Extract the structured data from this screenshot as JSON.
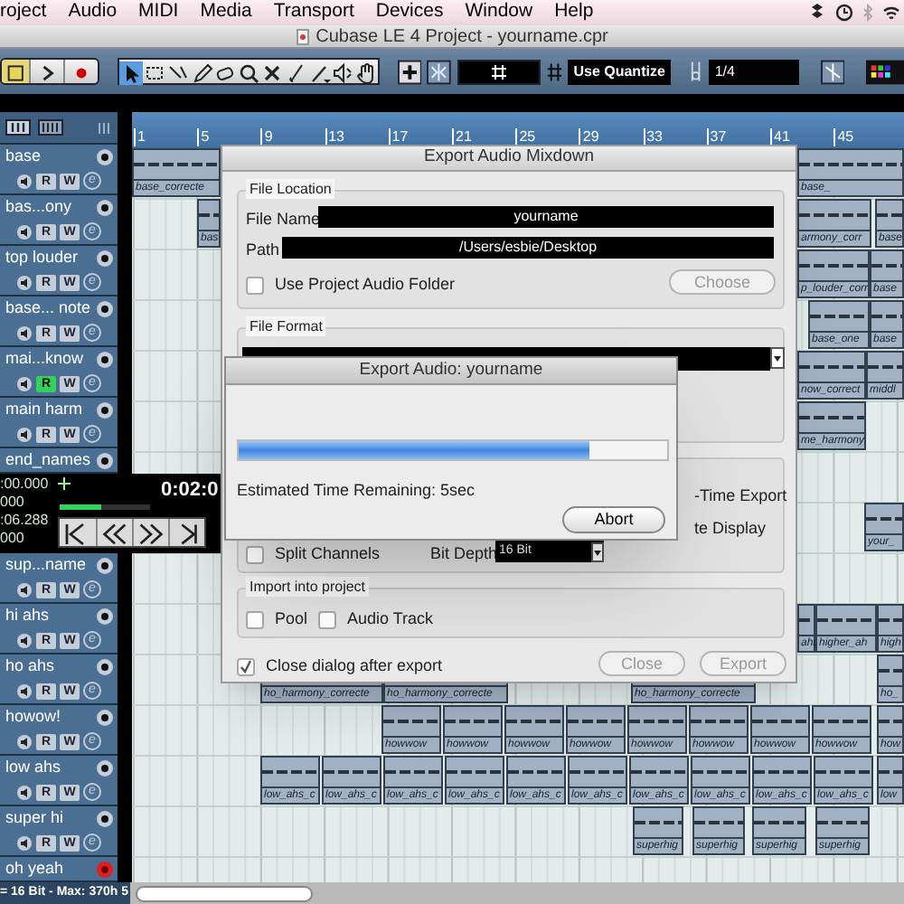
{
  "menu_bar": {
    "items": [
      "roject",
      "Audio",
      "MIDI",
      "Media",
      "Transport",
      "Devices",
      "Window",
      "Help"
    ]
  },
  "window": {
    "title": "Cubase LE 4 Project - yourname.cpr"
  },
  "toolbar": {
    "tools": [
      {
        "selected": true
      },
      {
        "selected": false
      },
      {
        "selected": false
      },
      {
        "selected": false
      },
      {
        "selected": false
      },
      {
        "selected": false
      },
      {
        "selected": false
      },
      {
        "selected": false
      },
      {
        "selected": false
      },
      {
        "selected": false
      },
      {
        "selected": false
      }
    ],
    "quantize": "Use Quantize",
    "quantize_value": "1/4"
  },
  "track_list": {
    "upper": [
      {
        "name": "base",
        "read": false,
        "record": false,
        "buttons": [
          "R",
          "W",
          "e"
        ]
      },
      {
        "name": "bas...ony",
        "read": false,
        "record": false,
        "buttons": [
          "R",
          "W",
          "e"
        ]
      },
      {
        "name": "top louder",
        "read": false,
        "record": false,
        "buttons": [
          "R",
          "W",
          "e"
        ]
      },
      {
        "name": "base... note",
        "read": false,
        "record": false,
        "buttons": [
          "R",
          "W",
          "e"
        ]
      },
      {
        "name": "mai...know",
        "read": true,
        "record": false,
        "buttons": [
          "R",
          "W",
          "e"
        ]
      },
      {
        "name": "main harm",
        "read": false,
        "record": false,
        "buttons": [
          "R",
          "W",
          "e"
        ]
      },
      {
        "name": "end_names",
        "record": false
      }
    ],
    "lower": [
      {
        "name": "sup...name",
        "read": false,
        "record": false,
        "buttons": [
          "R",
          "W",
          "e"
        ]
      },
      {
        "name": "hi ahs",
        "read": false,
        "record": false,
        "buttons": [
          "R",
          "W",
          "e"
        ]
      },
      {
        "name": "ho ahs",
        "read": false,
        "record": false,
        "buttons": [
          "R",
          "W",
          "e"
        ]
      },
      {
        "name": "howow!",
        "read": false,
        "record": false,
        "buttons": [
          "R",
          "W",
          "e"
        ]
      },
      {
        "name": "low ahs",
        "read": false,
        "record": false,
        "buttons": [
          "R",
          "W",
          "e"
        ]
      },
      {
        "name": "super hi",
        "read": false,
        "record": false,
        "buttons": [
          "R",
          "W",
          "e"
        ]
      },
      {
        "name": "oh yeah",
        "record": true
      }
    ]
  },
  "transport": {
    "time_1": ":00.000",
    "time_2": "000",
    "main_time": "0:02:0",
    "time_3": ":06.288",
    "time_4": "000",
    "level": 0.45
  },
  "ruler": [
    "1",
    "5",
    "9",
    "13",
    "17",
    "21",
    "25",
    "29",
    "33",
    "37",
    "41",
    "45"
  ],
  "clips": [
    {
      "label": "base_correcte"
    },
    {
      "label": "base_"
    },
    {
      "label": "bas"
    },
    {
      "label": "armony_corr"
    },
    {
      "label": "base"
    },
    {
      "label": "p_louder_corr"
    },
    {
      "label": "base"
    },
    {
      "label": "base_one"
    },
    {
      "label": "base"
    },
    {
      "label": "now_correct"
    },
    {
      "label": "middl"
    },
    {
      "label": "me_harmony"
    },
    {
      "label": "your_"
    },
    {
      "label": "ahs"
    },
    {
      "label": "higher_ah"
    },
    {
      "label": "high"
    },
    {
      "label": "ho_harmony_correcte"
    },
    {
      "label": "ho_harmony_correcte"
    },
    {
      "label": "ho_harmony_correcte"
    },
    {
      "label": "ho_"
    },
    {
      "label": "howwow"
    },
    {
      "label": "howwow"
    },
    {
      "label": "howwow"
    },
    {
      "label": "howwow"
    },
    {
      "label": "howwow"
    },
    {
      "label": "howwow"
    },
    {
      "label": "howwow"
    },
    {
      "label": "howwow"
    },
    {
      "label": "how"
    },
    {
      "label": "low_ahs_c"
    },
    {
      "label": "low_ahs_c"
    },
    {
      "label": "low_ahs_c"
    },
    {
      "label": "low_ahs_c"
    },
    {
      "label": "low_ahs_c"
    },
    {
      "label": "low_ahs_c"
    },
    {
      "label": "low_ahs_c"
    },
    {
      "label": "low_ahs_c"
    },
    {
      "label": "low_ahs_c"
    },
    {
      "label": "low_ahs_c"
    },
    {
      "label": "low"
    },
    {
      "label": "superhig"
    },
    {
      "label": "superhig"
    },
    {
      "label": "superhig"
    },
    {
      "label": "superhig"
    }
  ],
  "mixdown_dialog": {
    "title": "Export Audio Mixdown",
    "file_location": {
      "title": "File Location",
      "file_name_label": "File Name",
      "file_name": "yourname",
      "path_label": "Path",
      "path": "/Users/esbie/Desktop",
      "use_project_folder": {
        "label": "Use Project Audio Folder",
        "checked": false
      },
      "choose_button": "Choose"
    },
    "file_format": {
      "title": "File Format"
    },
    "options": {
      "realtime_label": "-Time Export",
      "display_label": "te Display",
      "split_channels": {
        "label": "Split Channels",
        "checked": false
      },
      "bit_depth_label": "Bit Depth",
      "bit_depth": "16 Bit"
    },
    "import": {
      "title": "Import into project",
      "pool": {
        "label": "Pool",
        "checked": false
      },
      "audio_track": {
        "label": "Audio Track",
        "checked": false
      }
    },
    "close_after": {
      "label": "Close dialog after export",
      "checked": true
    },
    "buttons": [
      "Close",
      "Export"
    ]
  },
  "progress_dialog": {
    "title": "Export Audio: yourname",
    "level": 0.82,
    "remaining": "Estimated Time Remaining: 5sec",
    "button": "Abort"
  },
  "status_bar": {
    "text": "= 16 Bit - Max: 370h 5"
  }
}
